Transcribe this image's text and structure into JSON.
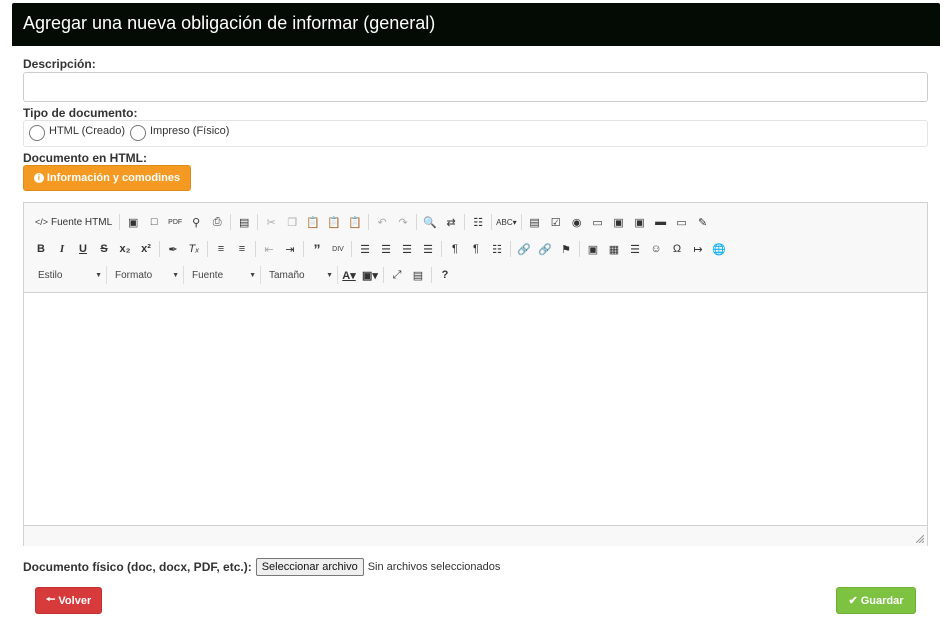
{
  "header": {
    "title": "Agregar una nueva obligación de informar (general)"
  },
  "form": {
    "description_label": "Descripción:",
    "description_value": "",
    "doc_type_label": "Tipo de documento:",
    "doc_type_options": [
      {
        "label": "HTML (Creado)",
        "selected": false
      },
      {
        "label": "Impreso (Físico)",
        "selected": false
      }
    ],
    "html_doc_label": "Documento en HTML:",
    "info_button": "Información y comodines",
    "physical_doc_label": "Documento físico (doc, docx, PDF, etc.):",
    "file_button": "Seleccionar archivo",
    "file_status": "Sin archivos seleccionados"
  },
  "editor": {
    "source_button": "Fuente HTML",
    "combos": {
      "style": "Estilo",
      "format": "Formato",
      "font": "Fuente",
      "size": "Tamaño"
    },
    "content": ""
  },
  "actions": {
    "back": "Volver",
    "save": "Guardar"
  },
  "colors": {
    "header_bg": "#040a04",
    "info": "#f49a22",
    "back": "#d73a3a",
    "save": "#7ec242"
  }
}
